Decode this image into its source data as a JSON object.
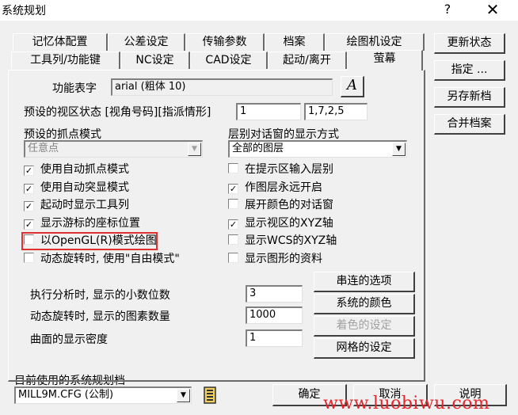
{
  "window": {
    "title": "系统规划",
    "help_glyph": "?",
    "close_glyph": "✕"
  },
  "tabs": {
    "row1": [
      "记忆体配置",
      "公差设定",
      "传输参数",
      "档案",
      "绘图机设定"
    ],
    "row2": [
      "工具列/功能键",
      "NC设定",
      "CAD设定",
      "起动/离开",
      "萤幕"
    ],
    "active": "萤幕"
  },
  "side_buttons": {
    "update_status": "更新状态",
    "assign": "指定 ...",
    "save_as_new": "另存新档",
    "merge": "合并档案"
  },
  "screen_tab": {
    "font_label": "功能表字",
    "font_value": "arial (粗体 10)",
    "font_button_glyph": "A",
    "viewport_label": "预设的视区状态 [视角号码][指派情形]",
    "viewport_value1": "1",
    "viewport_value2": "1,7,2,5",
    "snap_label": "预设的抓点模式",
    "snap_value": "任意点",
    "layer_label": "层别对话窗的显示方式",
    "layer_value": "全部的图层",
    "left_checks": [
      {
        "label": "使用自动抓点模式",
        "checked": true
      },
      {
        "label": "使用自动突显模式",
        "checked": true
      },
      {
        "label": "起动时显示工具列",
        "checked": true
      },
      {
        "label": "显示游标的座标位置",
        "checked": true
      },
      {
        "label": "以OpenGL(R)模式绘图",
        "checked": false
      },
      {
        "label": "动态旋转时, 使用\"自由模式\"",
        "checked": false
      }
    ],
    "right_checks": [
      {
        "label": "在提示区输入层别",
        "checked": false
      },
      {
        "label": "作图层永远开启",
        "checked": true
      },
      {
        "label": "展开颜色的对话窗",
        "checked": false
      },
      {
        "label": "显示视区的XYZ轴",
        "checked": true
      },
      {
        "label": "显示WCS的XYZ轴",
        "checked": false
      },
      {
        "label": "显示图形的资料",
        "checked": false
      }
    ],
    "decimals_label": "执行分析时, 显示的小数位数",
    "decimals_value": "3",
    "rotate_count_label": "动态旋转时, 显示的图素数量",
    "rotate_count_value": "1000",
    "surface_density_label": "曲面的显示密度",
    "surface_density_value": "1",
    "chain_button": "串连的选项",
    "colors_button": "系统的颜色",
    "shading_button": "着色的设定",
    "grid_button": "网格的设定"
  },
  "bottom": {
    "config_label": "目前使用的系统规划档",
    "config_value": "MILL9M.CFG (公制)",
    "ok": "确定",
    "cancel": "取消",
    "help": "说明"
  },
  "watermark": "www.luobiwu.com",
  "colors": {
    "dialog_bg": "#f0f0f0",
    "highlight_border": "#e03030",
    "watermark": "#e8242a"
  }
}
